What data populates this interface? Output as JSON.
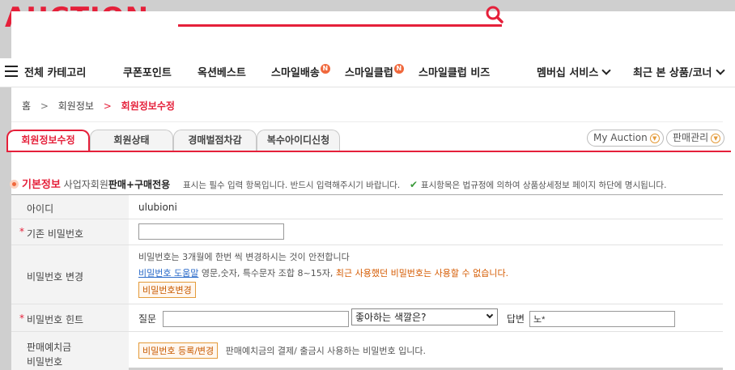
{
  "header": {
    "logo_text": "AUCTION.",
    "search_placeholder": ""
  },
  "gnb": {
    "all_categories": "전체 카테고리",
    "items": [
      {
        "label": "쿠폰포인트",
        "badge": ""
      },
      {
        "label": "옥션베스트",
        "badge": ""
      },
      {
        "label": "스마일배송",
        "badge": "N"
      },
      {
        "label": "스마일클럽",
        "badge": "N"
      },
      {
        "label": "스마일클럽 비즈",
        "badge": ""
      }
    ],
    "membership": "멤버십 서비스",
    "recent": "최근 본 상품/코너"
  },
  "breadcrumb": {
    "home": "홈",
    "level1": "회원정보",
    "current": "회원정보수정"
  },
  "tabs": [
    {
      "label": "회원정보수정",
      "active": true
    },
    {
      "label": "회원상태",
      "active": false
    },
    {
      "label": "경매벌점차감",
      "active": false
    },
    {
      "label": "복수아이디신청",
      "active": false
    }
  ],
  "right_links": {
    "my_auction": "My Auction",
    "sales_manage": "판매관리"
  },
  "section": {
    "title": "기본정보",
    "member_type": "사업자회원",
    "purpose": "판매+구매전용",
    "note1": "표시는 필수 입력 항목입니다. 반드시 입력해주시기 바랍니다.",
    "note2": "표시항목은 법규정에 의하여 상품상세정보 페이지 하단에 명시됩니다."
  },
  "form": {
    "id_label": "아이디",
    "id_value": "ulubioni",
    "current_pw_label": "기존 비밀번호",
    "current_pw_value": "",
    "change_pw_label": "비밀번호 변경",
    "change_pw_tip": "비밀번호는 3개월에 한번 씩 변경하시는 것이 안전합니다",
    "pw_help_link": "비밀번호 도움말",
    "pw_rule": "영문,숫자, 특수문자 조합 8~15자,",
    "pw_warning": "최근 사용했던 비밀번호는 사용할 수 없습니다.",
    "pw_change_button": "비밀번호변경",
    "hint_label": "비밀번호 힌트",
    "question_label": "질문",
    "question_value": "",
    "question_select": "좋아하는 색깔은?",
    "answer_label": "답변",
    "answer_value": "노*",
    "deposit_label_1": "판매예치금",
    "deposit_label_2": "비밀번호",
    "deposit_button": "비밀번호 등록/변경",
    "deposit_desc": "판매예치금의 결제/ 출금시 사용하는 비밀번호 입니다."
  },
  "colors": {
    "brand": "#e5203a",
    "badge": "#f0683c",
    "link": "#2b6bc9",
    "warning": "#d55a00"
  }
}
